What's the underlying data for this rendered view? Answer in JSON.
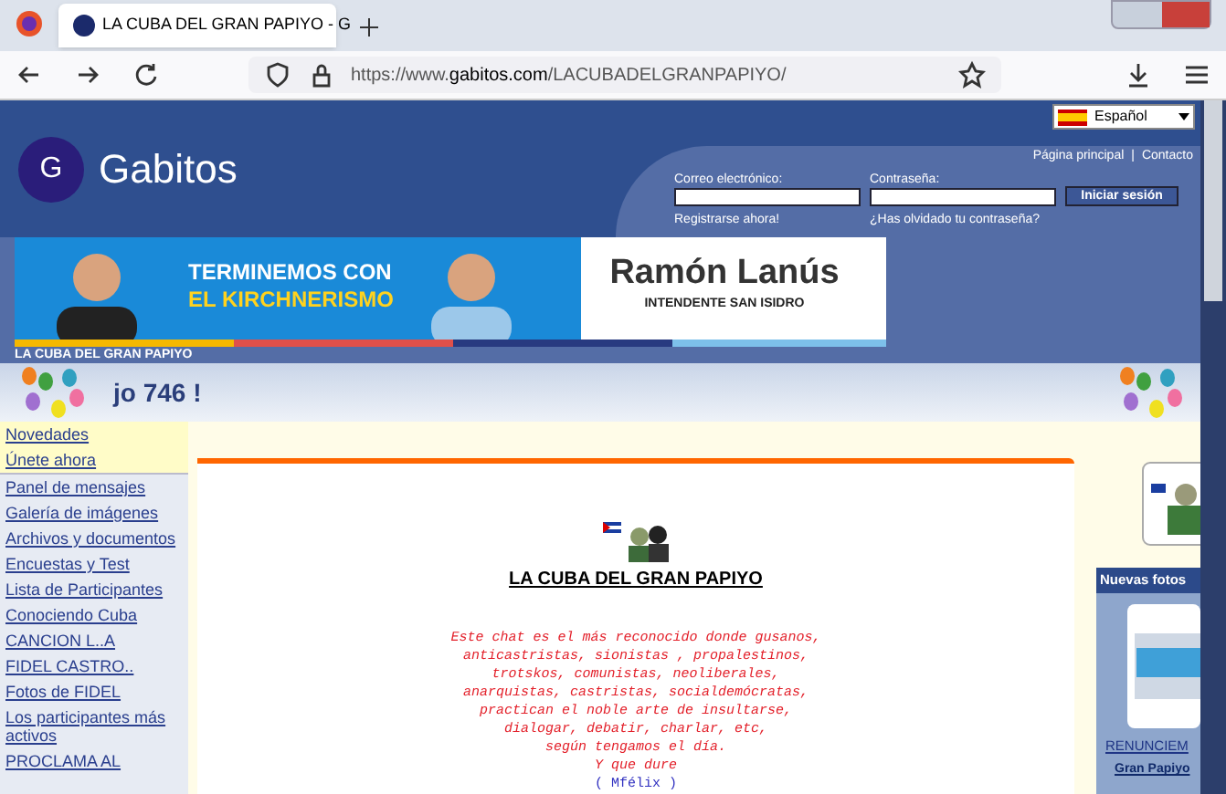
{
  "browser": {
    "tab_title": "LA CUBA DEL GRAN PAPIYO - G",
    "url_prefix": "https://www.",
    "url_domain": "gabitos.com",
    "url_path": "/LACUBADELGRANPAPIYO/"
  },
  "header": {
    "logo_letter": "G",
    "site_name": "Gabitos",
    "language": "Español",
    "links": [
      "Página principal",
      "Contacto"
    ],
    "separator": "|",
    "email_label": "Correo electrónico:",
    "password_label": "Contraseña:",
    "login_button": "Iniciar sesión",
    "register_link": "Registrarse ahora!",
    "forgot_link": "¿Has olvidado tu contraseña?"
  },
  "ad": {
    "headline_1": "TERMINEMOS CON",
    "headline_2": "EL KIRCHNERISMO",
    "name": "Ramón Lanús",
    "subtitle": "INTENDENTE SAN ISIDRO"
  },
  "group_title": "LA CUBA DEL GRAN PAPIYO",
  "banner_text": "jo 746 !",
  "sidebar": {
    "items": [
      {
        "label": "Novedades",
        "highlight": true
      },
      {
        "label": "Únete ahora",
        "highlight": true
      },
      {
        "label": "Panel de mensajes",
        "highlight": false
      },
      {
        "label": "Galería de imágenes",
        "highlight": false
      },
      {
        "label": "Archivos y documentos",
        "highlight": false
      },
      {
        "label": "Encuestas y Test",
        "highlight": false
      },
      {
        "label": "Lista de Participantes",
        "highlight": false
      },
      {
        "label": "Conociendo Cuba",
        "highlight": false
      },
      {
        "label": "CANCION L..A",
        "highlight": false
      },
      {
        "label": "FIDEL CASTRO..",
        "highlight": false
      },
      {
        "label": "Fotos de FIDEL",
        "highlight": false
      },
      {
        "label": "Los participantes más activos",
        "highlight": false
      },
      {
        "label": "PROCLAMA AL",
        "highlight": false
      }
    ]
  },
  "main": {
    "title": "LA CUBA DEL GRAN PAPIYO",
    "lines": [
      "Este chat es el más reconocido donde gusanos,",
      "anticastristas, sionistas , propalestinos,",
      "trotskos, comunistas, neoliberales,",
      "anarquistas, castristas, socialdemócratas,",
      "practican el noble arte de insultarse,",
      "dialogar, debatir, charlar, etc,",
      "según tengamos el día.",
      "Y que dure"
    ],
    "signature": "( Mfélix )"
  },
  "right": {
    "photos_title": "Nuevas fotos",
    "photo_caption": "RENUNCIEM",
    "photo_author": "Gran Papiyo"
  }
}
